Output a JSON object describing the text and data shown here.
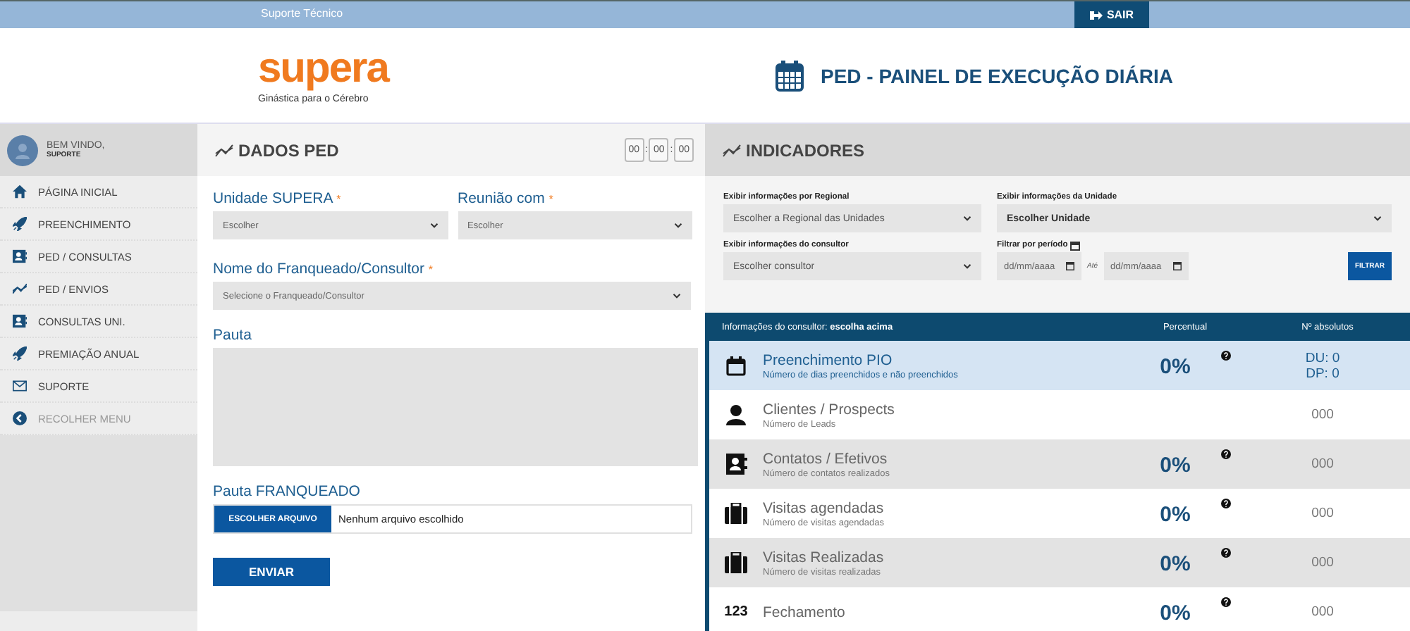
{
  "topbar": {
    "label": "Suporte Técnico",
    "logout": "SAIR"
  },
  "header": {
    "logo": "supera",
    "tagline": "Ginástica para o Cérebro",
    "title": "PED - PAINEL DE EXECUÇÃO DIÁRIA"
  },
  "user": {
    "greeting": "BEM VINDO,",
    "name": "SUPORTE"
  },
  "sidebar": {
    "items": [
      {
        "label": "PÁGINA INICIAL",
        "kind": "home",
        "dimmed": false
      },
      {
        "label": "PREENCHIMENTO",
        "kind": "rocket",
        "dimmed": false
      },
      {
        "label": "PED / CONSULTAS",
        "kind": "card",
        "dimmed": false
      },
      {
        "label": "PED / ENVIOS",
        "kind": "trend",
        "dimmed": false
      },
      {
        "label": "CONSULTAS UNI.",
        "kind": "card",
        "dimmed": false
      },
      {
        "label": "PREMIAÇÃO ANUAL",
        "kind": "rocket",
        "dimmed": false
      },
      {
        "label": "SUPORTE",
        "kind": "mail",
        "dimmed": false
      },
      {
        "label": "RECOLHER MENU",
        "kind": "back",
        "dimmed": true
      }
    ]
  },
  "dados_ped": {
    "title": "DADOS PED",
    "timer": {
      "parts": [
        "00",
        "00",
        "00"
      ],
      "separators": [
        ":",
        ":"
      ]
    },
    "unidade": {
      "label": "Unidade SUPERA",
      "required_mark": "*",
      "placeholder": "Escolher"
    },
    "reuniao": {
      "label": "Reunião com",
      "required_mark": "*",
      "placeholder": "Escolher"
    },
    "franqueado": {
      "label": "Nome do Franqueado/Consultor",
      "required_mark": "*",
      "placeholder": "Selecione o Franqueado/Consultor"
    },
    "pauta": {
      "label": "Pauta"
    },
    "pauta_franqueado": {
      "label": "Pauta FRANQUEADO",
      "button": "ESCOLHER ARQUIVO",
      "file": "Nenhum arquivo escolhido"
    },
    "submit": "ENVIAR"
  },
  "indicadores": {
    "title": "INDICADORES",
    "filters": {
      "regional": {
        "label": "Exibir informações por Regional",
        "value": "Escolher a Regional das Unidades"
      },
      "unidade": {
        "label": "Exibir informações da Unidade",
        "value": "Escolher Unidade"
      },
      "consultor": {
        "label": "Exibir informações do consultor",
        "value": "Escolher consultor"
      },
      "periodo": {
        "label": "Filtrar por período",
        "from": "dd/mm/aaaa",
        "between": "Até",
        "to": "dd/mm/aaaa"
      },
      "button": "FILTRAR"
    },
    "table": {
      "caption": "Informações do consultor: **escolha acima**",
      "columns": [
        "Percentual",
        "Nº absolutos"
      ],
      "rows": [
        {
          "kind": "calendar",
          "title": "Preenchimento PIO",
          "subtitle": "Número de dias preenchidos e não preenchidos",
          "percent": "0%",
          "help": true,
          "absolutes": [
            "DU: 0",
            "DP: 0"
          ],
          "highlighted": true
        },
        {
          "kind": "person",
          "title": "Clientes / Prospects",
          "subtitle": "Número de Leads",
          "help": false,
          "absolutes": [
            "000"
          ],
          "highlighted": false
        },
        {
          "kind": "card",
          "title": "Contatos / Efetivos",
          "subtitle": "Número de contatos realizados",
          "percent": "0%",
          "help": true,
          "absolutes": [
            "000"
          ],
          "highlighted": false
        },
        {
          "kind": "briefcase",
          "title": "Visitas agendadas",
          "subtitle": "Número de visitas agendadas",
          "percent": "0%",
          "help": true,
          "absolutes": [
            "000"
          ],
          "highlighted": false
        },
        {
          "kind": "briefcase",
          "title": "Visitas Realizadas",
          "subtitle": "Número de visitas realizadas",
          "percent": "0%",
          "help": true,
          "absolutes": [
            "000"
          ],
          "highlighted": false
        },
        {
          "kind": "text",
          "icon_text": "123",
          "title": "Fechamento",
          "percent": "0%",
          "help": true,
          "absolutes": [
            "000"
          ],
          "highlighted": false
        }
      ]
    }
  }
}
